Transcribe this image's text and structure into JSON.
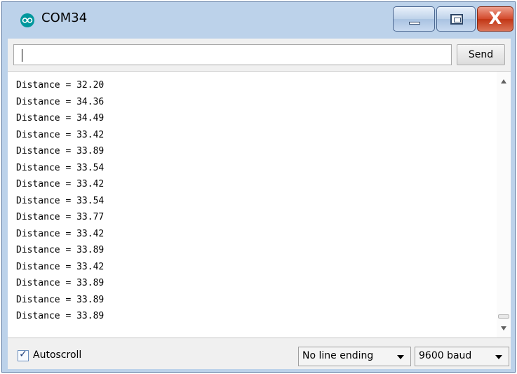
{
  "window": {
    "title": "COM34",
    "app_icon": "arduino-logo-icon",
    "close_glyph": "X"
  },
  "send_bar": {
    "input_value": "",
    "send_label": "Send"
  },
  "output": {
    "lines": [
      "Distance = 32.20",
      "Distance = 34.36",
      "Distance = 34.49",
      "Distance = 33.42",
      "Distance = 33.89",
      "Distance = 33.54",
      "Distance = 33.42",
      "Distance = 33.54",
      "Distance = 33.77",
      "Distance = 33.42",
      "Distance = 33.89",
      "Distance = 33.42",
      "Distance = 33.89",
      "Distance = 33.89",
      "Distance = 33.89"
    ]
  },
  "bottom_bar": {
    "autoscroll_label": "Autoscroll",
    "autoscroll_checked": true,
    "line_ending": "No line ending",
    "baud": "9600 baud"
  },
  "colors": {
    "title_frame": "#bcd2ea",
    "close_button": "#c7442a",
    "arduino_teal": "#00979c"
  }
}
